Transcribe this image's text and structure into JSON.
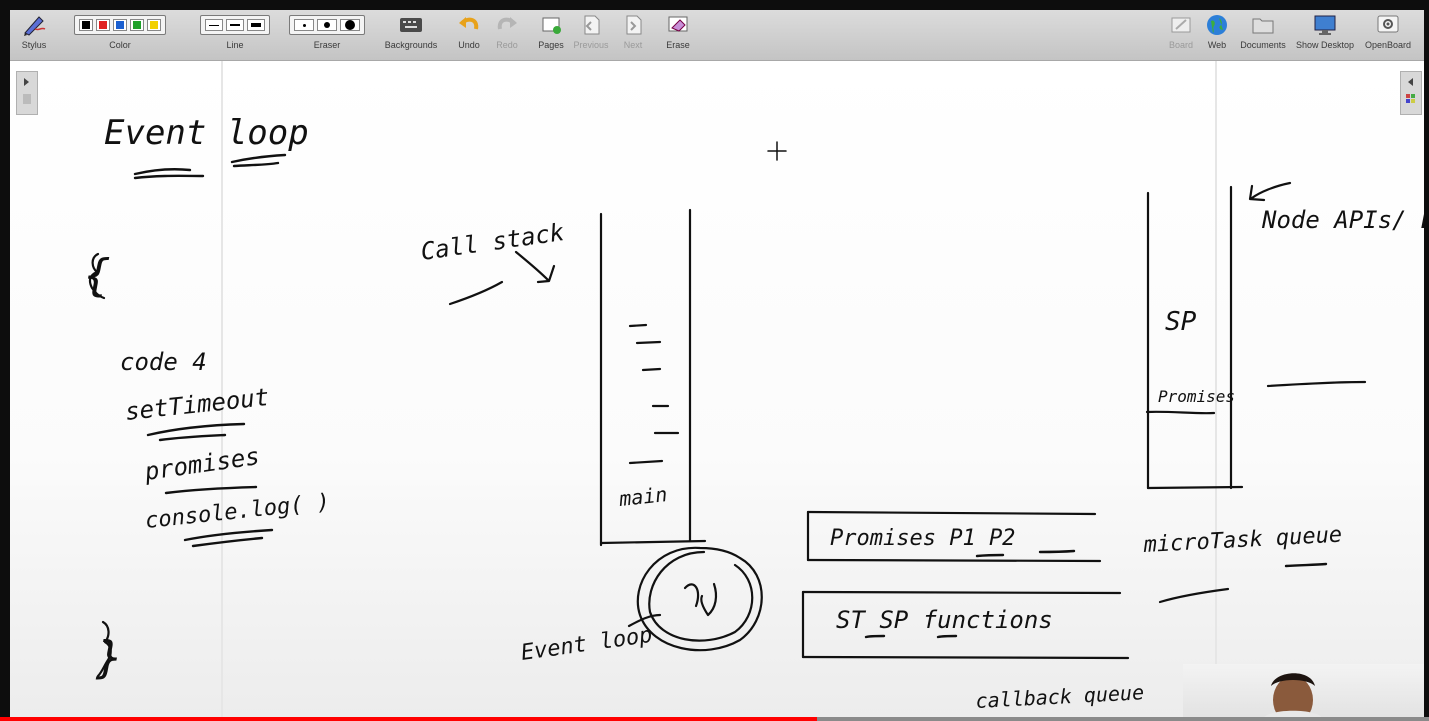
{
  "toolbar": {
    "stylus": "Stylus",
    "color": "Color",
    "line": "Line",
    "eraser": "Eraser",
    "backgrounds": "Backgrounds",
    "undo": "Undo",
    "redo": "Redo",
    "pages": "Pages",
    "previous": "Previous",
    "next": "Next",
    "erase": "Erase",
    "board": "Board",
    "web": "Web",
    "documents": "Documents",
    "show_desktop": "Show Desktop",
    "openboard": "OpenBoard"
  },
  "colors": {
    "palette": [
      "#000000",
      "#e02020",
      "#1a5fd0",
      "#1fa02a",
      "#f2d000"
    ],
    "accent_progress": "#ff0000",
    "ink": "#111111"
  },
  "board": {
    "handwriting": [
      "Event loop",
      "{",
      "code 4",
      "setTimeout",
      "promises",
      "console.log( )",
      "}",
      "Call stack",
      "main",
      "Event loop",
      "SP",
      "Promises",
      "Node APIs/ Browser API",
      "Promises P1 P2",
      "microTask queue",
      "ST SP functions",
      "callback queue"
    ]
  },
  "video": {
    "progress_fraction": 0.572
  }
}
